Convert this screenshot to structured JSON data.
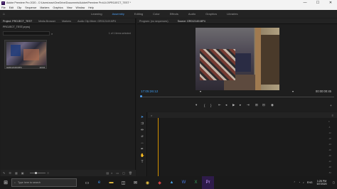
{
  "window": {
    "app_icon": "Pr",
    "title": "Adobe Premiere Pro 2020 - C:\\Users\\rose\\OneDrive\\Documents\\Adobe\\Premiere Pro\\14.0\\PROJECT_TEST *",
    "minimize": "—",
    "maximize": "☐",
    "close": "✕"
  },
  "menu": [
    "File",
    "Edit",
    "Clip",
    "Sequence",
    "Markers",
    "Graphics",
    "View",
    "Window",
    "Help"
  ],
  "workspaces": {
    "home_icon": "home-icon",
    "items": [
      "Learning",
      "Assembly",
      "Editing",
      "Color",
      "Effects",
      "Audio",
      "Graphics",
      "Libraries"
    ],
    "active": "Assembly"
  },
  "project_panel": {
    "tabs": [
      "Project: PROJECT_TEST",
      "Media Browser",
      "Markers",
      "Audio Clip Mixer: GR012149.MP4"
    ],
    "path": "PROJECT_TEST.prproj",
    "search_placeholder": "",
    "item_count": "1 of 1 items selected",
    "clip": {
      "name": "GR012149.MP4",
      "duration": "10:04"
    }
  },
  "program_monitor": {
    "tabs": [
      "Program: (no sequences)",
      "Source: GR012149.MP4"
    ],
    "timecode_in": "17:05:26:12",
    "fit": "Fit",
    "full": "Full",
    "timecode_duration": "00:00:00:45"
  },
  "tools": [
    "selection-tool",
    "track-select-tool",
    "ripple-edit-tool",
    "razor-tool",
    "slip-tool",
    "pen-tool",
    "hand-tool",
    "type-tool"
  ],
  "timeline": {
    "meter_labels": [
      "0",
      "-6",
      "-12",
      "-18",
      "-24",
      "-30",
      "-36",
      "-42",
      "-48",
      "-54"
    ]
  },
  "taskbar": {
    "search_placeholder": "Type here to search",
    "time": "1:26 PM",
    "date": "5/7/2020",
    "tray_label": "ENG"
  }
}
